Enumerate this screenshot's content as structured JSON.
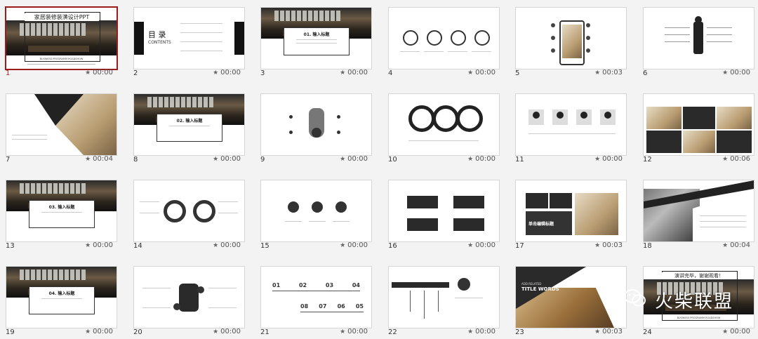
{
  "slides": [
    {
      "number": "1",
      "time": "00:00",
      "title": "家居装修装潢设计PPT",
      "subtitle": "BUSINESS PROGRAMM ROADSHOW"
    },
    {
      "number": "2",
      "time": "00:00",
      "title": "目 录",
      "subtitle": "CONTENTS"
    },
    {
      "number": "3",
      "time": "00:00",
      "title": "01. 输入标题"
    },
    {
      "number": "4",
      "time": "00:00"
    },
    {
      "number": "5",
      "time": "00:03"
    },
    {
      "number": "6",
      "time": "00:00"
    },
    {
      "number": "7",
      "time": "00:04"
    },
    {
      "number": "8",
      "time": "00:00",
      "title": "02. 输入标题"
    },
    {
      "number": "9",
      "time": "00:00"
    },
    {
      "number": "10",
      "time": "00:00"
    },
    {
      "number": "11",
      "time": "00:00"
    },
    {
      "number": "12",
      "time": "00:06"
    },
    {
      "number": "13",
      "time": "00:00",
      "title": "03. 输入标题"
    },
    {
      "number": "14",
      "time": "00:00"
    },
    {
      "number": "15",
      "time": "00:00"
    },
    {
      "number": "16",
      "time": "00:00"
    },
    {
      "number": "17",
      "time": "00:03",
      "title": "单击编辑标题"
    },
    {
      "number": "18",
      "time": "00:04"
    },
    {
      "number": "19",
      "time": "00:00",
      "title": "04. 输入标题"
    },
    {
      "number": "20",
      "time": "00:00"
    },
    {
      "number": "21",
      "time": "00:00",
      "steps_top": [
        "01",
        "02",
        "03",
        "04"
      ],
      "steps_bottom": [
        "08",
        "07",
        "06",
        "05"
      ]
    },
    {
      "number": "22",
      "time": "00:00"
    },
    {
      "number": "23",
      "time": "00:03",
      "title": "ADD RELATED",
      "subtitle": "TITLE WORDS"
    },
    {
      "number": "24",
      "time": "00:00",
      "title": "演讲完毕，谢谢观看！",
      "subtitle": "BUSINESS PROGRAMM ROADSHOW"
    }
  ],
  "selected_slide": "1",
  "star_icon": "★",
  "watermark": {
    "text": "火柴联盟",
    "icon": "wechat-icon"
  },
  "colors": {
    "selected_border": "#9b1c1c",
    "selected_number": "#b22222"
  }
}
